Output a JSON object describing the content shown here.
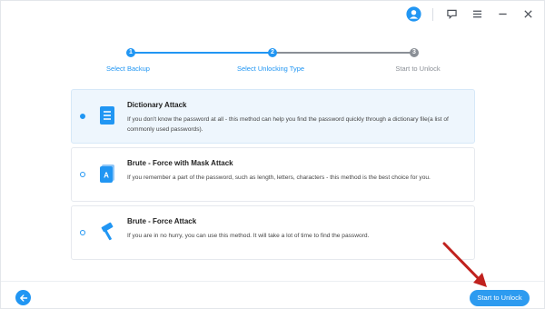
{
  "titlebar": {
    "icons": [
      "user-avatar-icon",
      "feedback-icon",
      "menu-icon",
      "minimize-icon",
      "close-icon"
    ]
  },
  "steps": [
    {
      "number": "1",
      "label": "Select Backup",
      "state": "done"
    },
    {
      "number": "2",
      "label": "Select Unlocking Type",
      "state": "active"
    },
    {
      "number": "3",
      "label": "Start to Unlock",
      "state": "pending"
    }
  ],
  "options": [
    {
      "title": "Dictionary Attack",
      "description": "If you don't know the password at all - this method can help you find the password quickly through a dictionary file(a list of commonly used passwords).",
      "selected": true,
      "icon": "dictionary-file-icon"
    },
    {
      "title": "Brute - Force with Mask Attack",
      "description": "If you remember a part of the password, such as length, letters, characters - this method is the best choice for you.",
      "selected": false,
      "icon": "mask-document-icon"
    },
    {
      "title": "Brute - Force Attack",
      "description": "If you are in no hurry, you can use this method. It will take a lot of time to find the password.",
      "selected": false,
      "icon": "hammer-icon"
    }
  ],
  "footer": {
    "back_icon": "back-arrow-icon",
    "start_label": "Start to Unlock"
  },
  "colors": {
    "accent": "#2196f3",
    "pending": "#8a8f96",
    "annotation_arrow": "#c0221e"
  }
}
